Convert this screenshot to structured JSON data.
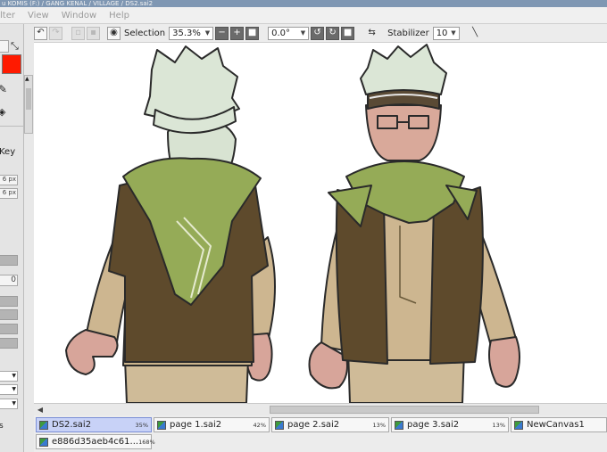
{
  "window": {
    "title": "u KOMIS (F:) / GANG KENAL / VILLAGE / DS2.sai2"
  },
  "menu": {
    "items": [
      "lter",
      "View",
      "Window",
      "Help"
    ]
  },
  "toolbar": {
    "selection_label": "Selection",
    "zoom_value": "35.3%",
    "rotation_value": "0.0°",
    "stabilizer_label": "Stabilizer",
    "stabilizer_value": "10"
  },
  "left_panel": {
    "key_label": "Key",
    "size1": "6 px",
    "size2": "6 px",
    "value": "0",
    "colors": {
      "secondary": "#f4f4f4",
      "primary": "#ff1a00"
    }
  },
  "tabs": [
    {
      "name": "DS2.sai2",
      "zoom": "35%",
      "active": true
    },
    {
      "name": "page 1.sai2",
      "zoom": "42%",
      "active": false
    },
    {
      "name": "page 2.sai2",
      "zoom": "13%",
      "active": false
    },
    {
      "name": "page 3.sai2",
      "zoom": "13%",
      "active": false
    },
    {
      "name": "NewCanvas1",
      "zoom": "",
      "active": false
    },
    {
      "name": "e886d35aeb4c61...",
      "zoom": "168%",
      "active": false
    }
  ]
}
